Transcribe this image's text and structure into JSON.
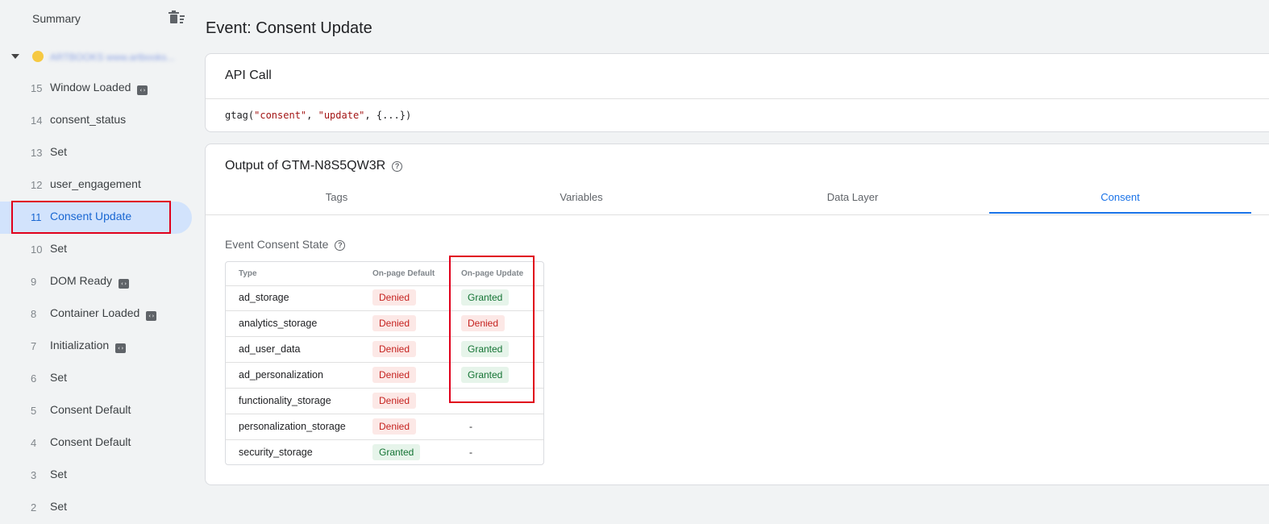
{
  "sidebar": {
    "heading": "Summary",
    "container_label": "ARTBOOKS www.artbooks...",
    "items": [
      {
        "num": "15",
        "label": "Window Loaded",
        "badge": true
      },
      {
        "num": "14",
        "label": "consent_status",
        "badge": false
      },
      {
        "num": "13",
        "label": "Set",
        "badge": false
      },
      {
        "num": "12",
        "label": "user_engagement",
        "badge": false
      },
      {
        "num": "11",
        "label": "Consent Update",
        "badge": false
      },
      {
        "num": "10",
        "label": "Set",
        "badge": false
      },
      {
        "num": "9",
        "label": "DOM Ready",
        "badge": true
      },
      {
        "num": "8",
        "label": "Container Loaded",
        "badge": true
      },
      {
        "num": "7",
        "label": "Initialization",
        "badge": true
      },
      {
        "num": "6",
        "label": "Set",
        "badge": false
      },
      {
        "num": "5",
        "label": "Consent Default",
        "badge": false
      },
      {
        "num": "4",
        "label": "Consent Default",
        "badge": false
      },
      {
        "num": "3",
        "label": "Set",
        "badge": false
      },
      {
        "num": "2",
        "label": "Set",
        "badge": false
      }
    ]
  },
  "main": {
    "title": "Event: Consent Update",
    "api_call": {
      "title": "API Call",
      "code_prefix": "gtag(",
      "code_arg1": "\"consent\"",
      "code_sep1": ", ",
      "code_arg2": "\"update\"",
      "code_suffix": ", {...})"
    },
    "output": {
      "title": "Output of GTM-N8S5QW3R",
      "tabs": [
        "Tags",
        "Variables",
        "Data Layer",
        "Consent"
      ],
      "active_tab": "Consent",
      "section_title": "Event Consent State",
      "table": {
        "headers": [
          "Type",
          "On-page Default",
          "On-page Update"
        ],
        "rows": [
          {
            "type": "ad_storage",
            "default": "Denied",
            "update": "Granted"
          },
          {
            "type": "analytics_storage",
            "default": "Denied",
            "update": "Denied"
          },
          {
            "type": "ad_user_data",
            "default": "Denied",
            "update": "Granted"
          },
          {
            "type": "ad_personalization",
            "default": "Denied",
            "update": "Granted"
          },
          {
            "type": "functionality_storage",
            "default": "Denied",
            "update": ""
          },
          {
            "type": "personalization_storage",
            "default": "Denied",
            "update": "-"
          },
          {
            "type": "security_storage",
            "default": "Granted",
            "update": "-"
          }
        ]
      }
    }
  },
  "colors": {
    "accent": "#1a73e8",
    "highlight_box": "#e0001b",
    "denied_bg": "#fce8e6",
    "granted_bg": "#e6f4ea"
  }
}
